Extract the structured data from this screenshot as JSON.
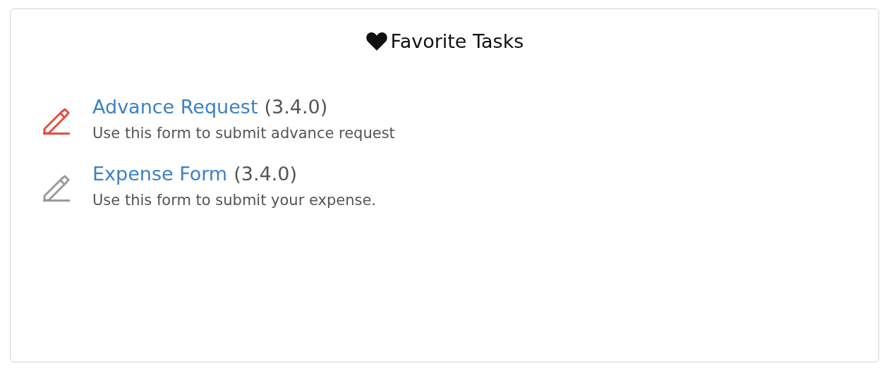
{
  "card": {
    "title": "Favorite Tasks"
  },
  "tasks": [
    {
      "name": "Advance Request",
      "version": "(3.4.0)",
      "description": "Use this form to submit advance request",
      "color": "#e0503e"
    },
    {
      "name": "Expense Form",
      "version": "(3.4.0)",
      "description": "Use this form to submit your expense.",
      "color": "#9a9a9a"
    }
  ]
}
